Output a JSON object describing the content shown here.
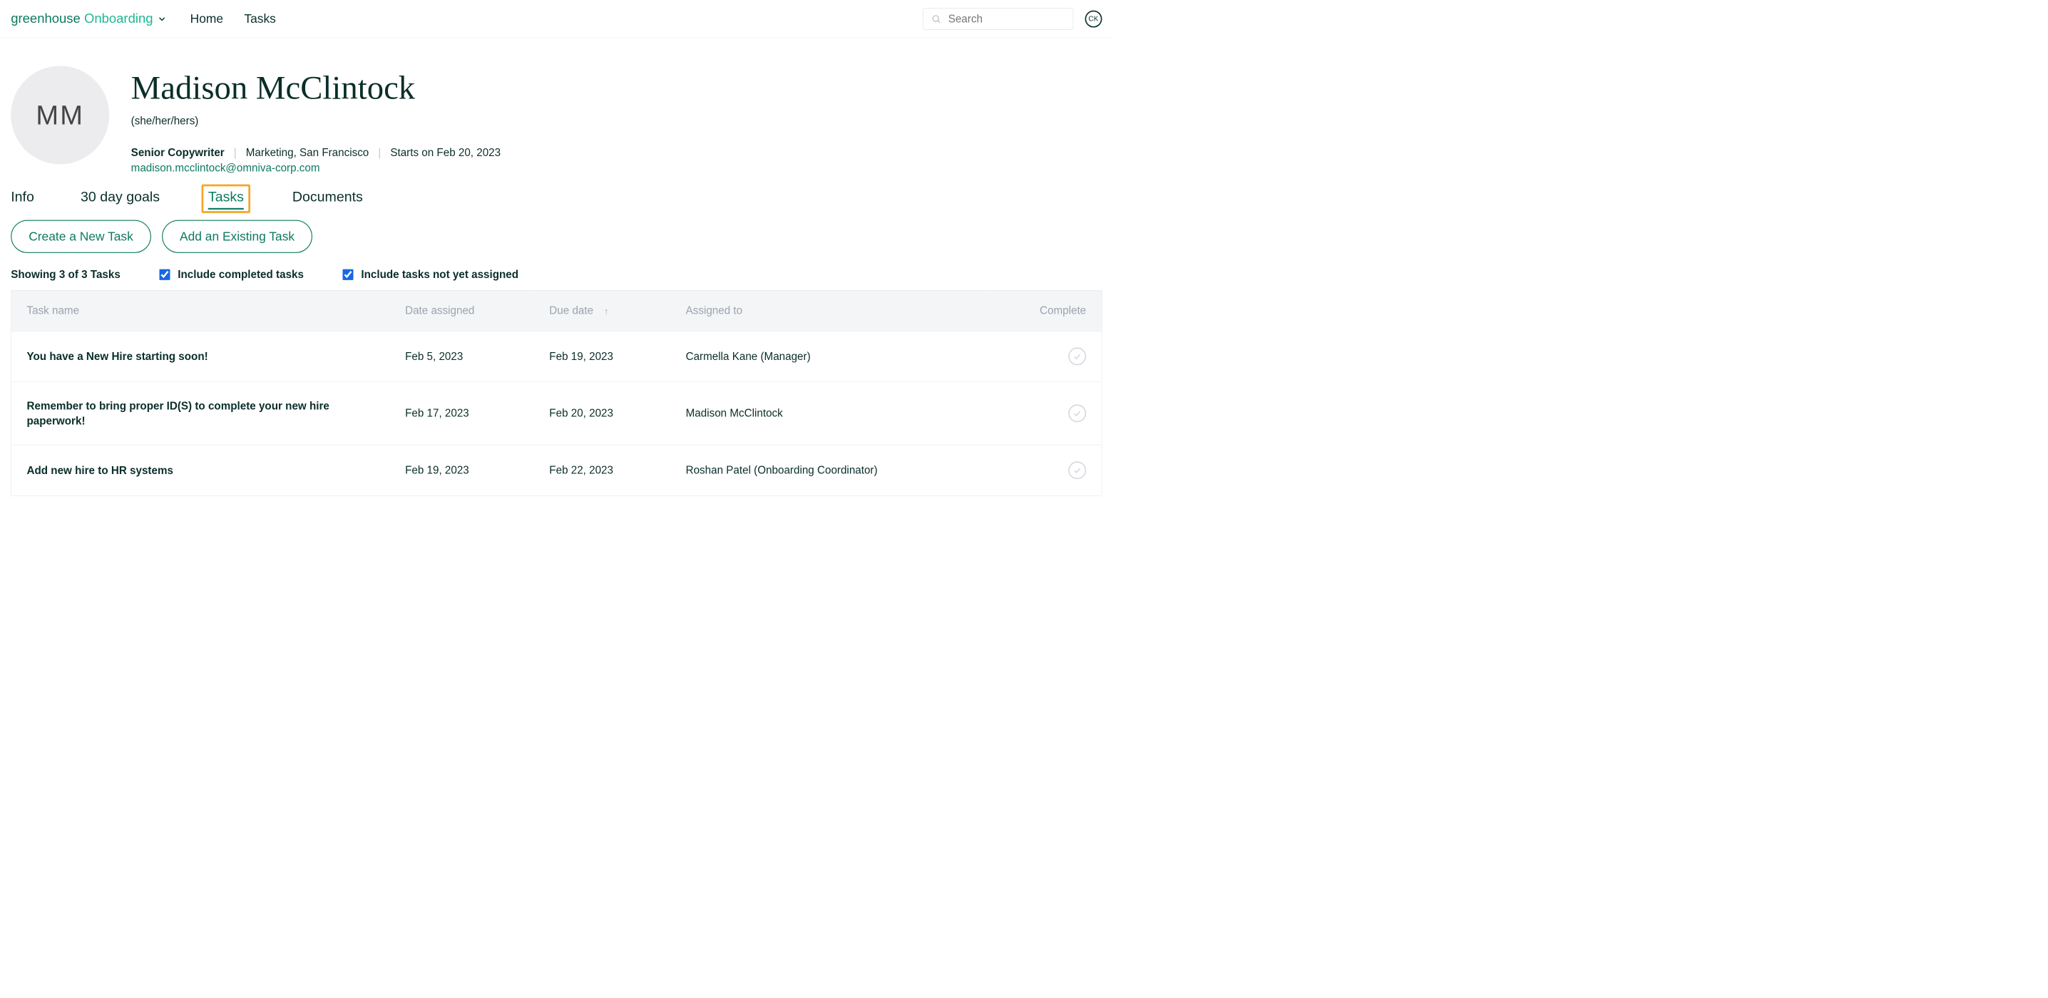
{
  "brand": {
    "name1": "greenhouse",
    "name2": " Onboarding"
  },
  "nav": {
    "home": "Home",
    "tasks": "Tasks"
  },
  "search": {
    "placeholder": "Search"
  },
  "user": {
    "initials": "CK"
  },
  "profile": {
    "initials": "MM",
    "name": "Madison McClintock",
    "pronouns": "(she/her/hers)",
    "title": "Senior Copywriter",
    "dept_loc": "Marketing, San Francisco",
    "start": "Starts on Feb 20, 2023",
    "email": "madison.mcclintock@omniva-corp.com"
  },
  "tabs": {
    "info": "Info",
    "goals": "30 day goals",
    "tasks": "Tasks",
    "documents": "Documents"
  },
  "buttons": {
    "create": "Create a New Task",
    "add_existing": "Add an Existing Task"
  },
  "filters": {
    "count": "Showing 3 of 3 Tasks",
    "include_completed": "Include completed tasks",
    "include_unassigned": "Include tasks not yet assigned"
  },
  "table": {
    "headers": {
      "name": "Task name",
      "assigned": "Date assigned",
      "due": "Due date",
      "to": "Assigned to",
      "complete": "Complete"
    },
    "rows": [
      {
        "name": "You have a New Hire starting soon!",
        "assigned": "Feb 5, 2023",
        "due": "Feb 19, 2023",
        "to": "Carmella Kane (Manager)"
      },
      {
        "name": "Remember to bring proper ID(S) to complete your new hire paperwork!",
        "assigned": "Feb 17, 2023",
        "due": "Feb 20, 2023",
        "to": "Madison McClintock"
      },
      {
        "name": "Add new hire to HR systems",
        "assigned": "Feb 19, 2023",
        "due": "Feb 22, 2023",
        "to": "Roshan Patel (Onboarding Coordinator)"
      }
    ]
  }
}
